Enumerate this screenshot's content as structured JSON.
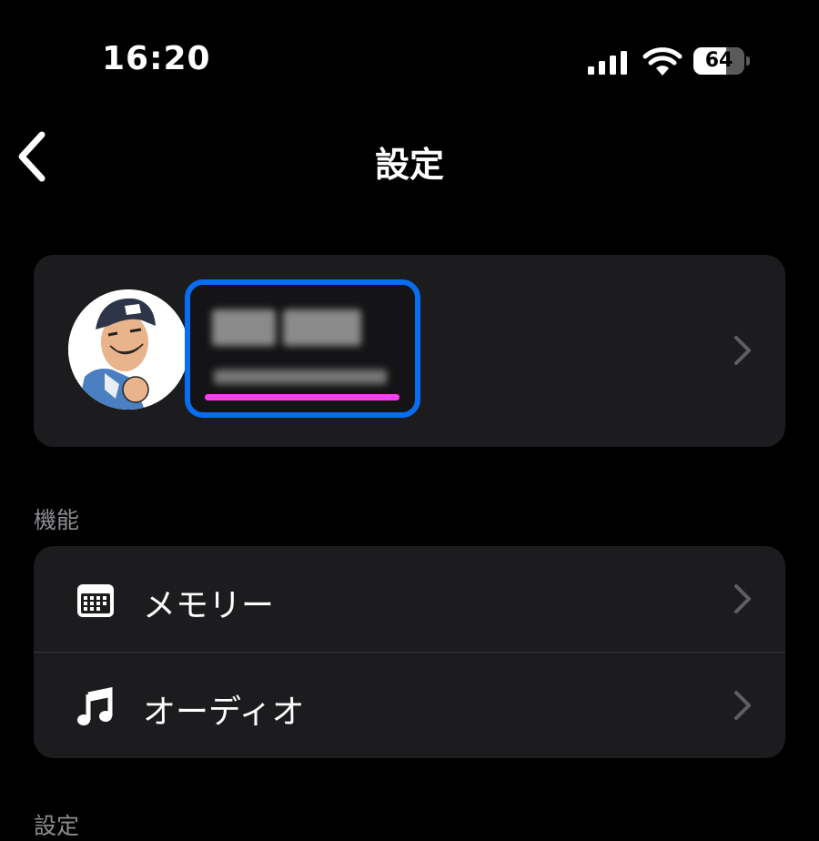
{
  "status_bar": {
    "time": "16:20",
    "battery_level": "64",
    "battery_fraction": 0.64
  },
  "nav": {
    "title": "設定",
    "back_icon": "chevron-left-icon"
  },
  "profile": {
    "name": "",
    "email": "",
    "note": "name and email are pixelated/obscured in the screenshot",
    "highlight_border_color": "#0a6cf0",
    "highlight_underline_color": "#ff3cf3"
  },
  "features_section": {
    "header": "機能",
    "items": [
      {
        "label": "メモリー",
        "icon": "calendar-icon"
      },
      {
        "label": "オーディオ",
        "icon": "music-note-icon"
      }
    ]
  },
  "next_section": {
    "header": "設定"
  },
  "colors": {
    "background": "#000000",
    "card": "#1c1c1e",
    "secondary_text": "#8d8d92",
    "chevron": "#5e5e63"
  }
}
